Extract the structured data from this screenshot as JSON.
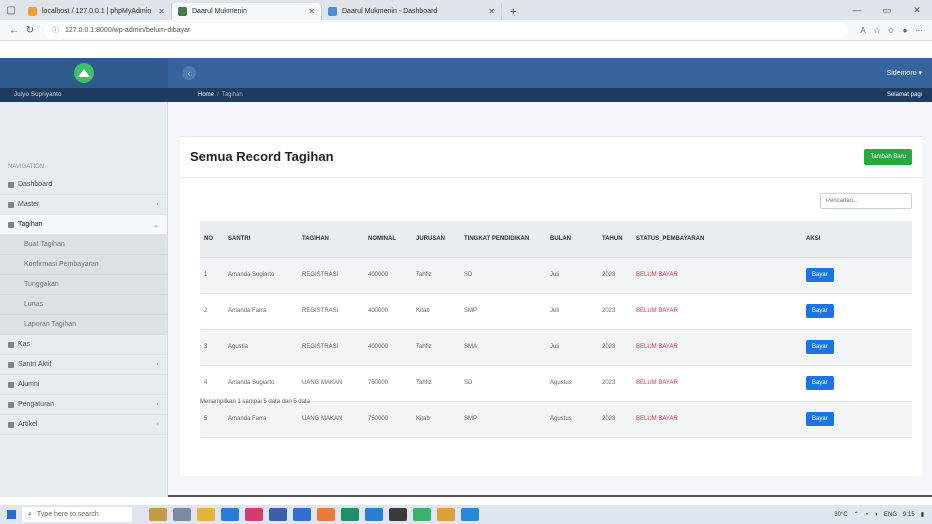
{
  "browser": {
    "tabs": [
      {
        "label": "localhost / 127.0.0.1 | phpMyAdmin",
        "active": false,
        "color": "#f0a030"
      },
      {
        "label": "Daarul Mukmenin",
        "active": true,
        "color": "#3f7c4e"
      },
      {
        "label": "Daarul Mukmenin - Dashboard",
        "active": false,
        "color": "#4a90d9"
      }
    ],
    "url": "127.0.0.1:8000/wp-admin/belum-dibayar"
  },
  "header": {
    "user_menu": "Sidemoro ▾",
    "user_name": "Julyo Supriyanto",
    "breadcrumb_home": "Home",
    "breadcrumb_current": "Tagihan",
    "sub_right": "Selamat pagi"
  },
  "sidebar": {
    "section_label": "NAVIGATION",
    "items": [
      {
        "label": "Dashboard",
        "chev": false
      },
      {
        "label": "Master",
        "chev": true
      },
      {
        "label": "Tagihan",
        "chev": true,
        "active": true
      },
      {
        "label": "Buat Tagihan",
        "sub": true
      },
      {
        "label": "Konfirmasi Pembayaran",
        "sub": true
      },
      {
        "label": "Tunggakan",
        "sub": true
      },
      {
        "label": "Lunas",
        "sub": true
      },
      {
        "label": "Laporan Tagihan",
        "sub": true
      },
      {
        "label": "Kas",
        "chev": false
      },
      {
        "label": "Santri Aktif",
        "chev": true
      },
      {
        "label": "Alumni",
        "chev": false
      },
      {
        "label": "Pengaturan",
        "chev": true
      },
      {
        "label": "Artikel",
        "chev": true
      }
    ]
  },
  "card": {
    "title": "Semua Record Tagihan",
    "add_button": "Tambah Baru",
    "search_placeholder": "Pencarian...",
    "info": "Menampilkan 1 sampai 5 data dari 5 data",
    "pay_label": "Bayar"
  },
  "table": {
    "headers": [
      "NO",
      "SANTRI",
      "TAGIHAN",
      "NOMINAL",
      "JURUSAN",
      "TINGKAT PENDIDIKAN",
      "BULAN",
      "TAHUN",
      "STATUS_PEMBAYARAN",
      "AKSI"
    ],
    "rows": [
      [
        "1",
        "Amanda Sugiarto",
        "REGISTRASI",
        "400000",
        "Tahfiz",
        "SD",
        "Juli",
        "2023",
        "BELUM BAYAR"
      ],
      [
        "2",
        "Amanda Farra",
        "REGISTRASI",
        "400000",
        "Kitab",
        "SMP",
        "Juli",
        "2023",
        "BELUM BAYAR"
      ],
      [
        "3",
        "Agustia",
        "REGISTRASI",
        "400000",
        "Tahfiz",
        "SMA",
        "Juli",
        "2023",
        "BELUM BAYAR"
      ],
      [
        "4",
        "Amanda Sugiarto",
        "UANG MAKAN",
        "750000",
        "Tahfiz",
        "SD",
        "Agustus",
        "2023",
        "BELUM BAYAR"
      ],
      [
        "5",
        "Amanda Farra",
        "UANG MAKAN",
        "750000",
        "Kitab",
        "SMP",
        "Agustus",
        "2023",
        "BELUM BAYAR"
      ]
    ]
  },
  "taskbar": {
    "search_placeholder": "Type here to search",
    "weather": "30°C",
    "lang": "ENG",
    "time": "9:15"
  }
}
